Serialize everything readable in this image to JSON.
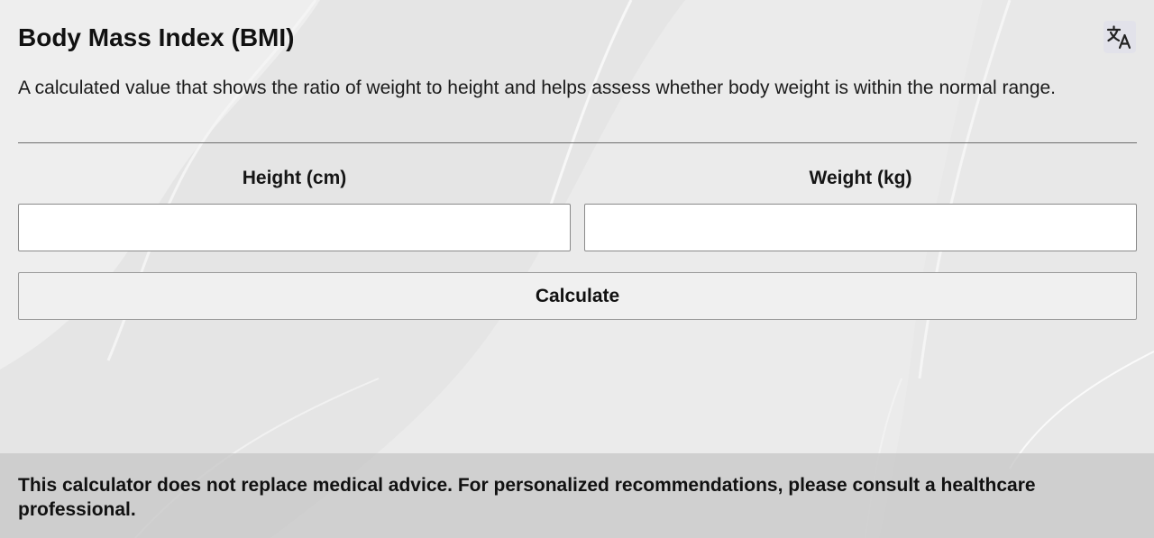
{
  "header": {
    "title": "Body Mass Index (BMI)",
    "language_icon": "translate-icon"
  },
  "description": "A calculated value that shows the ratio of weight to height and helps assess whether body weight is within the normal range.",
  "form": {
    "height_label": "Height (cm)",
    "height_value": "",
    "height_placeholder": "",
    "weight_label": "Weight (kg)",
    "weight_value": "",
    "weight_placeholder": "",
    "calculate_label": "Calculate"
  },
  "footer": {
    "disclaimer": "This calculator does not replace medical advice. For personalized recommendations, please consult a healthcare professional."
  },
  "colors": {
    "background": "#ececec",
    "footer_band": "#c8c8c8",
    "language_button": "#e2e2ea"
  }
}
